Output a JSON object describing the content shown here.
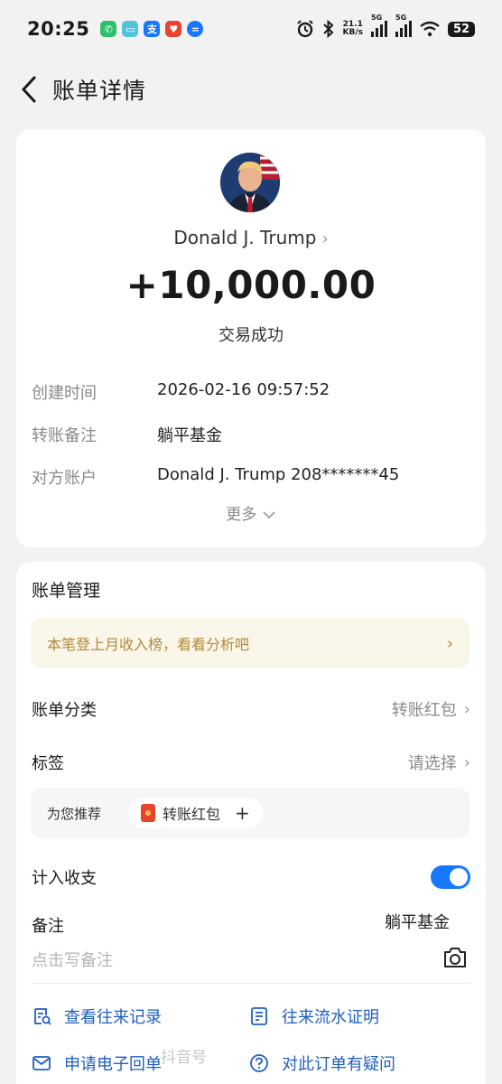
{
  "status_bar": {
    "time": "20:25",
    "net_speed_value": "21.1",
    "net_speed_unit": "KB/s",
    "signal_1_label": "5G",
    "signal_2_label": "5G",
    "battery": "52",
    "apps": [
      "phone",
      "message",
      "支",
      "health",
      "chat"
    ]
  },
  "header": {
    "title": "账单详情"
  },
  "transaction": {
    "payee": "Donald J. Trump",
    "amount": "+10,000.00",
    "status": "交易成功",
    "details": [
      {
        "label": "创建时间",
        "value": "2026-02-16 09:57:52"
      },
      {
        "label": "转账备注",
        "value": "躺平基金"
      },
      {
        "label": "对方账户",
        "value": "Donald J. Trump 208*******45"
      }
    ],
    "more_label": "更多"
  },
  "management": {
    "title": "账单管理",
    "promo_text": "本笔登上月收入榜，看看分析吧",
    "category_label": "账单分类",
    "category_value": "转账红包",
    "tag_label": "标签",
    "tag_value": "请选择",
    "recommend_label": "为您推荐",
    "recommend_chip": "转账红包",
    "count_in_label": "计入收支",
    "count_in_enabled": true,
    "remark_label": "备注",
    "remark_value": "躺平基金",
    "remark_placeholder": "点击写备注"
  },
  "actions": {
    "view_records": "查看往来记录",
    "flow_proof": "往来流水证明",
    "e_receipt": "申请电子回单",
    "question": "对此订单有疑问"
  },
  "watermark": "抖音号",
  "colors": {
    "accent": "#1677ff",
    "promo_text": "#b08a3a",
    "link": "#1f5fbf"
  }
}
